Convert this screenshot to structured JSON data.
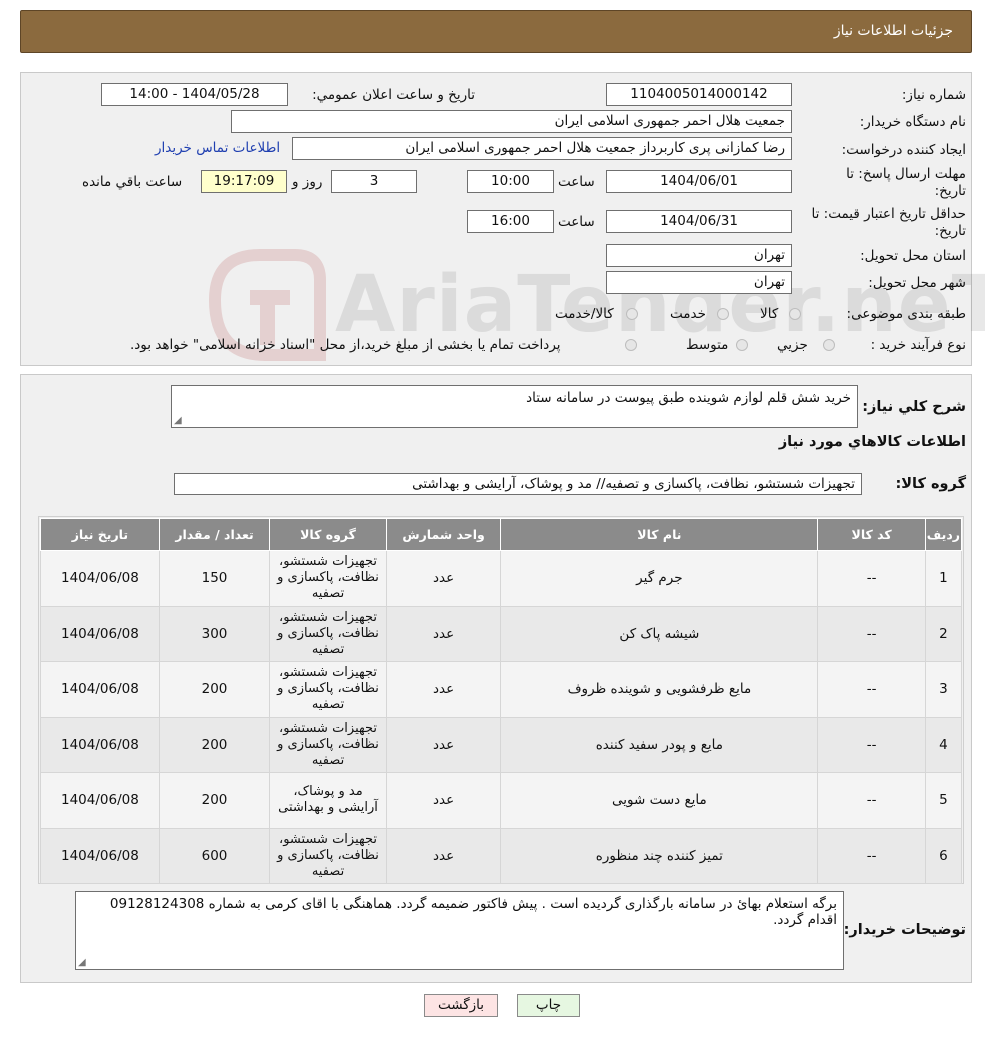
{
  "header": {
    "title": "جزئیات اطلاعات نیاز"
  },
  "fields": {
    "need_number_label": "شماره نیاز:",
    "need_number": "1104005014000142",
    "announce_label": "تاریخ و ساعت اعلان عمومي:",
    "announce_value": "1404/05/28 - 14:00",
    "buyer_org_label": "نام دستگاه خریدار:",
    "buyer_org": "جمعیت هلال احمر جمهوری اسلامی ایران",
    "requester_label": "ایجاد کننده درخواست:",
    "requester": "رضا کمازانی پری کاربرداز جمعیت هلال احمر جمهوری اسلامی ایران",
    "contact_link": "اطلاعات تماس خریدار",
    "reply_deadline_label_1": "مهلت ارسال پاسخ: تا",
    "reply_deadline_label_2": "تاریخ:",
    "reply_date": "1404/06/01",
    "time_label": "ساعت",
    "reply_time": "10:00",
    "days_value": "3",
    "days_label": "روز و",
    "remaining_time": "19:17:09",
    "remaining_label": "ساعت باقي مانده",
    "price_validity_label_1": "حداقل تاریخ اعتبار قیمت: تا",
    "price_validity_label_2": "تاریخ:",
    "price_validity_date": "1404/06/31",
    "price_validity_time": "16:00",
    "province_label": "استان محل تحویل:",
    "province": "تهران",
    "city_label": "شهر محل تحویل:",
    "city": "تهران",
    "category_label": "طبقه بندی موضوعی:",
    "category_options": [
      "کالا",
      "خدمت",
      "کالا/خدمت"
    ],
    "process_label": "نوع فرآیند خرید :",
    "process_options": [
      "جزیي",
      "متوسط"
    ],
    "process_note": "پرداخت تمام یا بخشی از مبلغ خرید،از محل \"اسناد خزانه اسلامی\" خواهد بود."
  },
  "description": {
    "label": "شرح کلي نیاز:",
    "value": "خرید شش قلم لوازم شوینده طبق پیوست در سامانه ستاد"
  },
  "goods_section_title": "اطلاعات کالاهاي مورد نیاز",
  "goods_group": {
    "label": "گروه کالا:",
    "value": "تجهیزات شستشو، نظافت، پاکسازی و تصفیه// مد و پوشاک، آرایشی و بهداشتی"
  },
  "table": {
    "headers": [
      "ردیف",
      "کد کالا",
      "نام کالا",
      "واحد شمارش",
      "گروه کالا",
      "تعداد / مقدار",
      "تاریخ نیاز"
    ],
    "rows": [
      [
        "1",
        "--",
        "جرم گیر",
        "عدد",
        "تجهیزات شستشو، نظافت، پاکسازی و تصفیه",
        "150",
        "1404/06/08"
      ],
      [
        "2",
        "--",
        "شیشه پاک کن",
        "عدد",
        "تجهیزات شستشو، نظافت، پاکسازی و تصفیه",
        "300",
        "1404/06/08"
      ],
      [
        "3",
        "--",
        "مایع ظرفشویی و شوینده ظروف",
        "عدد",
        "تجهیزات شستشو، نظافت، پاکسازی و تصفیه",
        "200",
        "1404/06/08"
      ],
      [
        "4",
        "--",
        "مایع و پودر سفید کننده",
        "عدد",
        "تجهیزات شستشو، نظافت، پاکسازی و تصفیه",
        "200",
        "1404/06/08"
      ],
      [
        "5",
        "--",
        "مایع دست شویی",
        "عدد",
        "مد و پوشاک، آرایشی و بهداشتی",
        "200",
        "1404/06/08"
      ],
      [
        "6",
        "--",
        "تمیز کننده چند منظوره",
        "عدد",
        "تجهیزات شستشو، نظافت، پاکسازی و تصفیه",
        "600",
        "1404/06/08"
      ]
    ]
  },
  "buyer_notes": {
    "label": "توضیحات خریدار:",
    "value": "برگه استعلام بهائ در سامانه بارگذاری گردیده است . پیش فاکتور ضمیمه گردد. هماهنگی با اقای کرمی به شماره 09128124308 اقدام گردد."
  },
  "buttons": {
    "print": "چاپ",
    "back": "بازگشت"
  },
  "watermark_text": "AriaTender.neT",
  "colors": {
    "header_bg": "#8b6a3e",
    "table_header_bg": "#8b8b8b",
    "link": "#1f3fb0",
    "back_button_bg": "#fde4e4",
    "print_button_bg": "#e6f7e1"
  }
}
